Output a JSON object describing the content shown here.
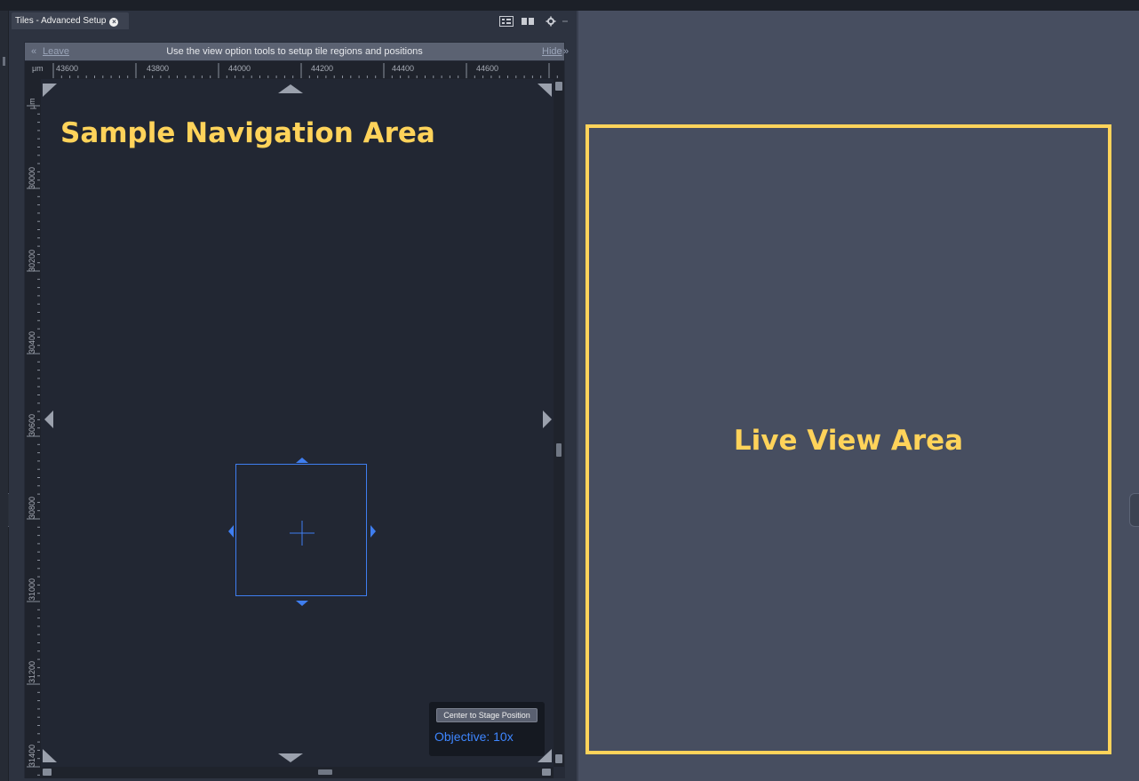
{
  "tab": {
    "title": "Tiles - Advanced Setup",
    "close_icon": "close-icon"
  },
  "toolbar": {
    "icons": [
      "grid-view-icon",
      "split-view-icon",
      "gear-icon",
      "dropdown-arrow-icon"
    ]
  },
  "info_bar": {
    "leave_chevron": "«",
    "leave_label": "Leave",
    "message": "Use the view option tools to setup tile regions and positions",
    "hide_label": "Hide",
    "hide_chevron": "»"
  },
  "ruler": {
    "unit": "μm",
    "top_ticks": [
      "43600",
      "43800",
      "44000",
      "44200",
      "44400",
      "44600"
    ],
    "left_ticks": [
      "30000",
      "30200",
      "30400",
      "30600",
      "30800",
      "31000",
      "31200",
      "31400"
    ]
  },
  "navigation": {
    "label": "Sample Navigation Area",
    "center_button": "Center to Stage Position",
    "objective_label": "Objective:",
    "objective_value": "10x"
  },
  "live_view": {
    "label": "Live View Area"
  },
  "colors": {
    "highlight": "#ffd35a",
    "navigator_blue": "#3f7ef0",
    "objective_text": "#3e86ff",
    "live_background": "#474e60",
    "nav_background": "#222733"
  }
}
